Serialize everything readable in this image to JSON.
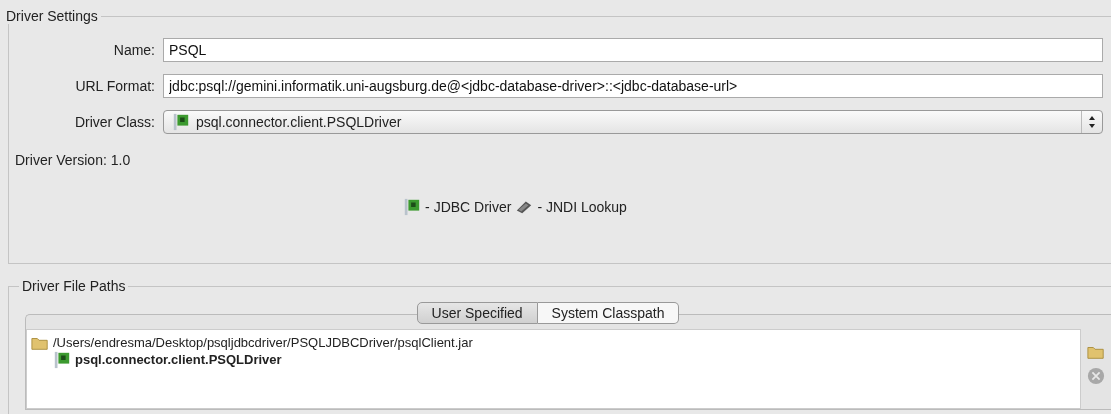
{
  "driver_settings": {
    "title": "Driver Settings",
    "name": {
      "label": "Name:",
      "value": "PSQL"
    },
    "url_format": {
      "label": "URL Format:",
      "value": "jdbc:psql://gemini.informatik.uni-augsburg.de@<jdbc-database-driver>::<jdbc-database-url>"
    },
    "driver_class": {
      "label": "Driver Class:",
      "value": "psql.connector.client.PSQLDriver"
    },
    "driver_version": {
      "label": "Driver Version:",
      "value": "1.0"
    },
    "legend": [
      {
        "kind": "jdbc",
        "label": "- JDBC Driver"
      },
      {
        "kind": "jndi",
        "label": "- JNDI Lookup"
      }
    ]
  },
  "driver_file_paths": {
    "title": "Driver File Paths",
    "tabs": [
      {
        "label": "User Specified",
        "selected": true
      },
      {
        "label": "System Classpath",
        "selected": false
      }
    ],
    "tree": [
      {
        "kind": "file",
        "label": "/Users/endresma/Desktop/psqljdbcdriver/PSQLJDBCDriver/psqlClient.jar",
        "children": [
          {
            "kind": "class",
            "label": "psql.connector.client.PSQLDriver"
          }
        ]
      }
    ],
    "side_buttons": [
      {
        "kind": "add",
        "disabled": false
      },
      {
        "kind": "remove",
        "disabled": true
      }
    ]
  }
}
